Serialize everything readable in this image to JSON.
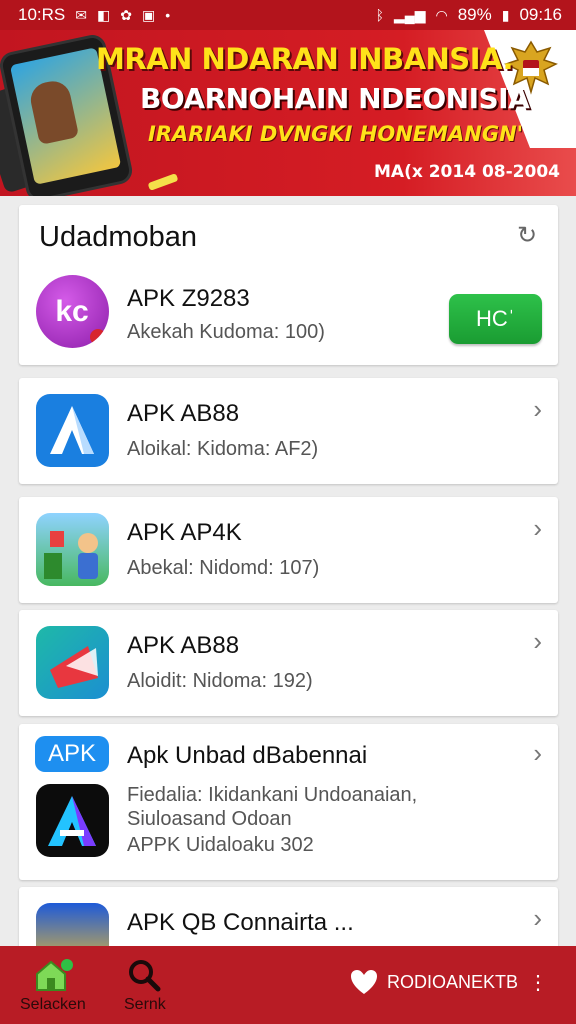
{
  "status_bar": {
    "time": "10:RS",
    "battery": "89%",
    "clock_right": "09:16",
    "icons": [
      "message-icon",
      "notification-icon",
      "app-icon",
      "mail-icon",
      "dot-icon",
      "bluetooth-icon",
      "signal-icon",
      "wifi-icon",
      "battery-icon"
    ]
  },
  "banner": {
    "line1": "MRAN NDARAN INBANSIA.",
    "line2": "BOARNOHAIN NDEONISIA",
    "line3": "IRARIAKI DVNGKI HONEMANGN'",
    "date": "MA(x 2014 08-2004",
    "colors": {
      "red": "#c21520",
      "yellow": "#ffe21a"
    }
  },
  "featured": {
    "title": "Udadmoban",
    "app": {
      "name": "APK Z9283",
      "sub": "Akekah  Kudoma: 100)",
      "button": "HCˈ"
    }
  },
  "apps": [
    {
      "name": "APK AB88",
      "sub": "Aloikal:  Kidoma: AF2)"
    },
    {
      "name": "APK AP4K",
      "sub": "Abekal:  Nidomd: 107)"
    },
    {
      "name": "APK AB88",
      "sub": "Aloidit:  Nidoma: 192)"
    }
  ],
  "promo_card": {
    "badge": "APK",
    "title": "Apk Unbad dBabennai",
    "line1": "Fiedalia: Ikidankani Undoanaian,",
    "line2": "Siuloasand Odoan",
    "line3": "APPK Uidaloaku 302"
  },
  "last_app": {
    "name": "APK QB Connairta ..."
  },
  "bottom_nav": {
    "home_label": "Selacken",
    "search_label": "Sernk",
    "right_label": "RODIOANEKTB"
  },
  "accent": {
    "install_green": "#22b03c",
    "nav_red": "#b81c25"
  }
}
